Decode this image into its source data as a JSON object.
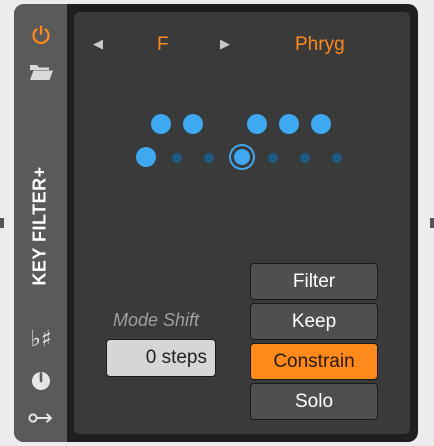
{
  "device": {
    "title": "KEY FILTER+",
    "power_icon": "power-icon",
    "preset_icon": "folder-icon",
    "accidental_label": "♭♯",
    "accidental_icon": "flat-sharp-icon",
    "dial_icon": "dial-icon",
    "routing_icon": "key-routing-icon"
  },
  "key": {
    "root": "F",
    "scale": "Phryg",
    "prev_icon": "triangle-left-icon",
    "next_icon": "triangle-right-icon",
    "upper_row_dots": 5,
    "lower_row_dots": 7,
    "highlighted_note_index": 3
  },
  "mode_shift": {
    "label": "Mode Shift",
    "value": "0 steps"
  },
  "modes": {
    "options": [
      "Filter",
      "Keep",
      "Constrain",
      "Solo"
    ],
    "selected": "Constrain"
  },
  "colors": {
    "accent_orange": "#ff8a1c",
    "note_blue": "#3ea8f0",
    "note_blue_dim": "#1e5b84",
    "panel": "#3a3a3a",
    "side_strip": "#5a5a5a"
  }
}
